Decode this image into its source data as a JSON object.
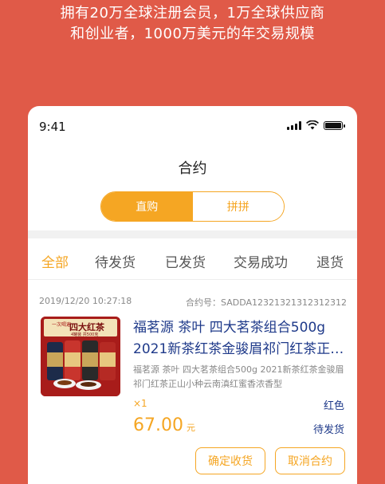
{
  "promo": {
    "line1": "拥有20万全球注册会员，1万全球供应商",
    "line2": "和创业者，1000万美元的年交易规模"
  },
  "status_bar": {
    "time": "9:41"
  },
  "page": {
    "title": "合约"
  },
  "segment": {
    "direct": "直购",
    "group": "拼拼",
    "active": "direct"
  },
  "tabs": [
    {
      "label": "全部",
      "active": true
    },
    {
      "label": "待发货",
      "active": false
    },
    {
      "label": "已发货",
      "active": false
    },
    {
      "label": "交易成功",
      "active": false
    },
    {
      "label": "退货",
      "active": false
    }
  ],
  "order": {
    "datetime": "2019/12/20 10:27:18",
    "contract_no": "合约号：SADDA12321321312312312",
    "product_title": "福茗源 茶叶 四大茗茶组合500g 2021新茶红茶金骏眉祁门红茶正山小种云南滇红蜜香浓香型",
    "product_desc": "福茗源 茶叶 四大茗茶组合500g 2021新茶红茶金骏眉祁门红茶正山小种云南滇红蜜香浓香型",
    "quantity": "×1",
    "color": "红色",
    "price": "67.00",
    "price_unit": "元",
    "status": "待发货",
    "image": {
      "banner_left": "一次喝遍",
      "banner_main": "四大红茶",
      "sub": "4罐装 共500克"
    }
  },
  "actions": {
    "confirm": "确定收货",
    "cancel": "取消合约"
  },
  "colors": {
    "background": "#e05a48",
    "accent": "#f5a623",
    "title_blue": "#1f3a8a"
  }
}
